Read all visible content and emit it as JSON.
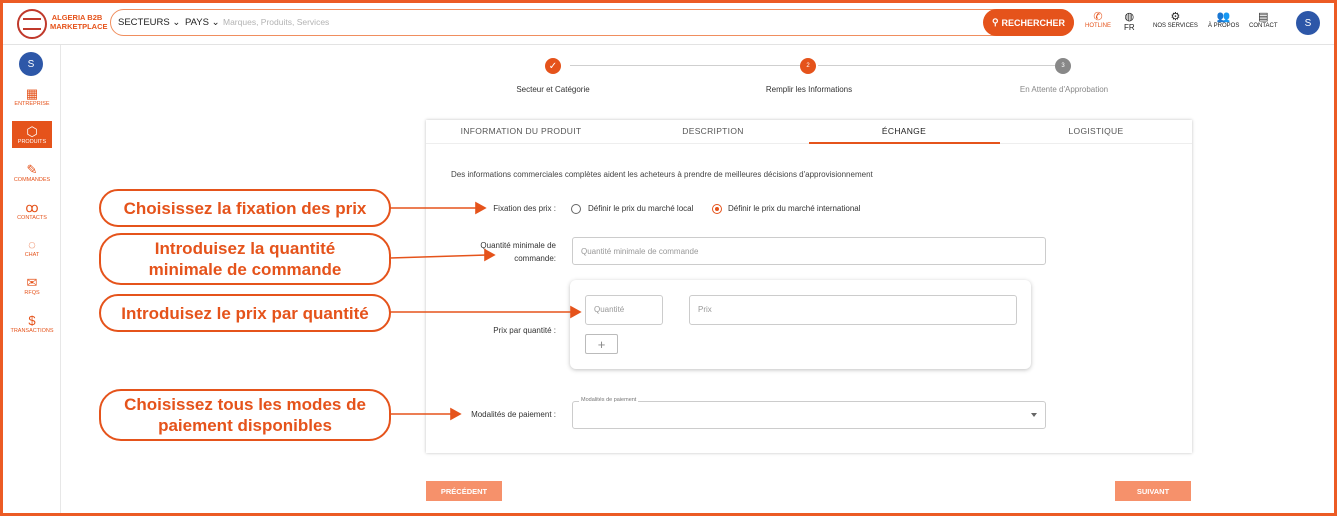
{
  "brand": {
    "line1": "ALGERIA B2B",
    "line2": "MARKETPLACE"
  },
  "search": {
    "sectors_label": "SECTEURS",
    "countries_label": "PAYS",
    "placeholder": "Marques, Produits, Services",
    "button_label": "RECHERCHER"
  },
  "topnav": {
    "hotline": "HOTLINE",
    "language": "FR",
    "services": "NOS SERVICES",
    "about": "À PROPOS",
    "contact": "CONTACT",
    "avatar": "S"
  },
  "sidebar": {
    "avatar": "S",
    "items": [
      {
        "label": "ENTREPRISE",
        "icon": "building-icon"
      },
      {
        "label": "PRODUITS",
        "icon": "box-icon"
      },
      {
        "label": "COMMANDES",
        "icon": "edit-icon"
      },
      {
        "label": "CONTACTS",
        "icon": "people-icon"
      },
      {
        "label": "CHAT",
        "icon": "chat-icon"
      },
      {
        "label": "RFQS",
        "icon": "mail-icon"
      },
      {
        "label": "TRANSACTIONS",
        "icon": "money-hand-icon"
      }
    ]
  },
  "stepper": {
    "steps": [
      {
        "number": "1",
        "label": "Secteur et Catégorie",
        "state": "done"
      },
      {
        "number": "2",
        "label": "Remplir les Informations",
        "state": "active"
      },
      {
        "number": "3",
        "label": "En Attente d'Approbation",
        "state": "pending"
      }
    ]
  },
  "tabs": [
    "INFORMATION DU PRODUIT",
    "DESCRIPTION",
    "ÉCHANGE",
    "LOGISTIQUE"
  ],
  "form": {
    "intro": "Des informations commerciales complètes aident les acheteurs à prendre de meilleures décisions d'approvisionnement",
    "pricing_label": "Fixation des prix :",
    "pricing_option_local": "Définir le prix du marché local",
    "pricing_option_intl": "Définir le prix du marché international",
    "moq_label_line1": "Quantité minimale de",
    "moq_label_line2": "commande:",
    "moq_placeholder": "Quantité minimale de commande",
    "price_qty_label": "Prix par quantité :",
    "qty_placeholder": "Quantité",
    "price_placeholder": "Prix",
    "add_label": "+",
    "payment_label": "Modalités de paiement :",
    "payment_legend": "Modalités de paiement"
  },
  "buttons": {
    "previous": "PRÉCÉDENT",
    "next": "SUIVANT"
  },
  "callouts": {
    "pricing": "Choisissez la fixation des prix",
    "moq_line1": "Introduisez la quantité",
    "moq_line2": "minimale de commande",
    "price": "Introduisez le prix par quantité",
    "payment_line1": "Choisissez tous les modes de",
    "payment_line2": "paiement disponibles"
  },
  "colors": {
    "accent": "#e5531b",
    "light_accent": "#f6916b",
    "avatar": "#2d57a8",
    "step_pending": "#888888"
  }
}
